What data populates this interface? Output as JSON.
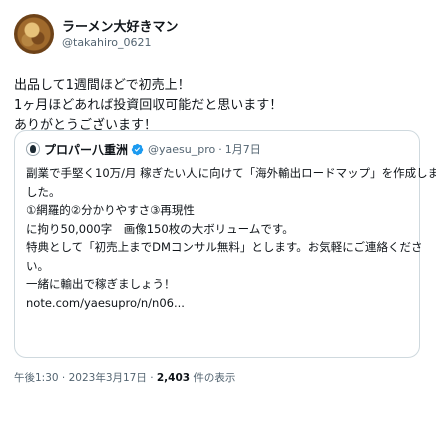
{
  "author": {
    "display_name": "ラーメン大好きマン",
    "handle": "@takahiro_0621"
  },
  "body_lines": [
    "出品して1週間ほどで初売上！",
    "1ヶ月ほどあれば投資回収可能だと思います！",
    "ありがとうございます！"
  ],
  "quoted": {
    "display_name": "プロパー八重洲",
    "handle": "@yaesu_pro",
    "separator": "·",
    "date": "1月7日",
    "lines": [
      "副業で手堅く10万/月 稼ぎたい人に向けて「海外輸出ロードマップ」を作成しま",
      "した。",
      "①網羅的②分かりやすさ③再現性",
      "に拘り50,000字　画像150枚の大ボリュームです。",
      "特典として「初売上までDMコンサル無料」とします。お気軽にご連絡くださ",
      "い。",
      "一緒に輸出で稼ぎましょう！",
      "note.com/yaesupro/n/n06..."
    ]
  },
  "meta": {
    "time_date": "午後1:30 · 2023年3月17日 · ",
    "views": "2,403",
    "views_suffix": " 件の表示"
  },
  "colors": {
    "text": "#0f1419",
    "secondary": "#536471",
    "verified": "#1d9bf0",
    "border": "#cfd9de"
  }
}
